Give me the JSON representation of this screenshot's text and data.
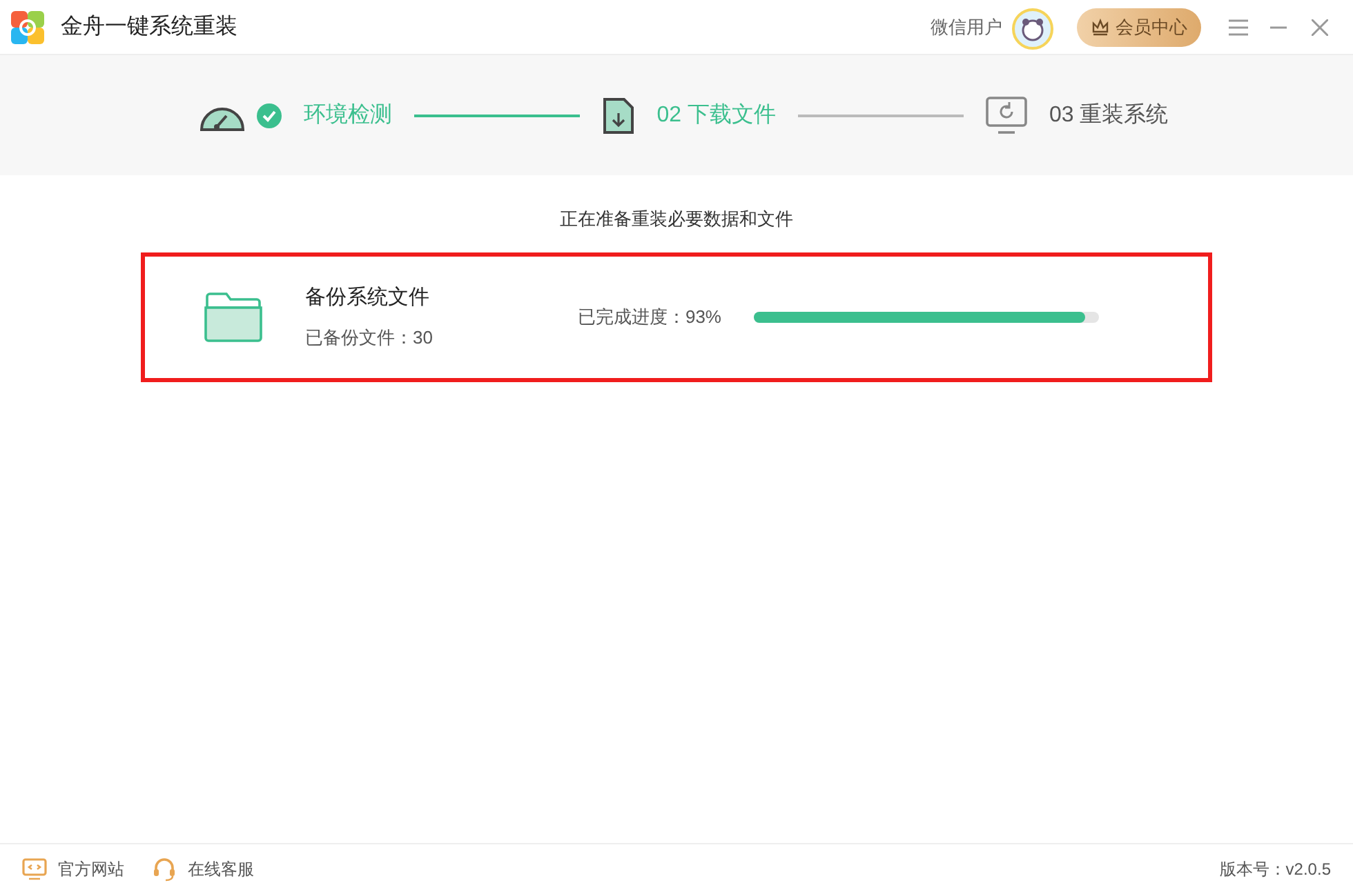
{
  "window": {
    "title": "金舟一键系统重装"
  },
  "user": {
    "name": "微信用户"
  },
  "member_button": {
    "label": "会员中心"
  },
  "steps": [
    {
      "label": "环境检测",
      "completed": true,
      "active": true
    },
    {
      "label": "02 下载文件",
      "completed": false,
      "active": true
    },
    {
      "label": "03 重装系统",
      "completed": false,
      "active": false
    }
  ],
  "status_message": "正在准备重装必要数据和文件",
  "task": {
    "title": "备份系统文件",
    "detail": "已备份文件：30",
    "progress_label": "已完成进度：93%",
    "level": 0.96,
    "highlighted": true
  },
  "footer": {
    "links": [
      {
        "label": "官方网站",
        "kind": "website"
      },
      {
        "label": "在线客服",
        "kind": "support"
      }
    ],
    "version": "版本号：v2.0.5"
  }
}
